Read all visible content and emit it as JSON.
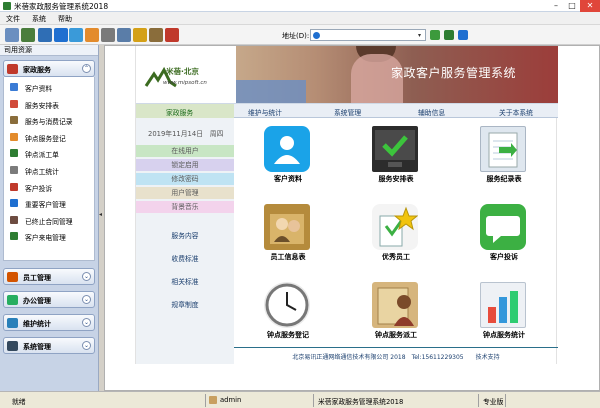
{
  "window": {
    "title": "米蓓家政服务管理系统2018"
  },
  "menu": [
    "文件",
    "系统",
    "帮助"
  ],
  "address": {
    "label": "地址(D):",
    "value": ""
  },
  "sidebar": {
    "header": "司用资源",
    "groups": [
      {
        "label": "家政服务",
        "toggle": "⌃",
        "icon_color": "#c0392b",
        "items": [
          {
            "label": "客户资料",
            "icon": "person-icon",
            "color": "#3a7bd5"
          },
          {
            "label": "服务安排表",
            "icon": "calendar-icon",
            "color": "#d14a3a"
          },
          {
            "label": "服务与消费记录",
            "icon": "record-icon",
            "color": "#8a6d3b"
          },
          {
            "label": "钟点服务登记",
            "icon": "clock-icon",
            "color": "#e38b2c"
          },
          {
            "label": "钟点派工单",
            "icon": "worker-icon",
            "color": "#2e7d32"
          },
          {
            "label": "钟点工统计",
            "icon": "stats-icon",
            "color": "#7b7b7b"
          },
          {
            "label": "客户投诉",
            "icon": "complaint-icon",
            "color": "#c0392b"
          },
          {
            "label": "重要客户管理",
            "icon": "vip-icon",
            "color": "#1f6fd0"
          },
          {
            "label": "已终止合同管理",
            "icon": "contract-icon",
            "color": "#6d4c41"
          },
          {
            "label": "客户来电管理",
            "icon": "phone-icon",
            "color": "#2e7d32"
          }
        ]
      },
      {
        "label": "员工管理",
        "toggle": "⌄",
        "icon_color": "#d35400"
      },
      {
        "label": "办公管理",
        "toggle": "⌄",
        "icon_color": "#27ae60"
      },
      {
        "label": "维护统计",
        "toggle": "⌄",
        "icon_color": "#2980b9"
      },
      {
        "label": "系统管理",
        "toggle": "⌄",
        "icon_color": "#34495e"
      }
    ]
  },
  "banner": {
    "logo_name": "米蓓·北京",
    "logo_url": "www.mipsoft.cn",
    "title": "家政客户服务管理系统"
  },
  "nav": [
    "家政服务",
    "维护与统计",
    "系统管理",
    "辅助信息",
    "关于本系统"
  ],
  "left_panel": {
    "date": "2019年11月14日　周四",
    "bars": [
      {
        "label": "在线用户",
        "color": "#c8e6c4"
      },
      {
        "label": "锁定启用",
        "color": "#d7d1ee"
      },
      {
        "label": "修改密码",
        "color": "#bfe3f3"
      },
      {
        "label": "用户管理",
        "color": "#e8e1cc"
      },
      {
        "label": "背景音乐",
        "color": "#f3d3ec"
      }
    ],
    "links": [
      "服务内容",
      "收费标准",
      "相关标准",
      "规章制度"
    ]
  },
  "tiles": [
    {
      "label": "客户资料",
      "icon": "customer-icon",
      "color": "#1aa3e8"
    },
    {
      "label": "服务安排表",
      "icon": "schedule-icon",
      "color": "#3b3b3b"
    },
    {
      "label": "服务纪录表",
      "icon": "record-sheet-icon",
      "color": "#dfe7ef"
    },
    {
      "label": "员工信息表",
      "icon": "staff-icon",
      "color": "#b58b3c"
    },
    {
      "label": "优秀员工",
      "icon": "star-book-icon",
      "color": "#f0f0f0"
    },
    {
      "label": "客户投诉",
      "icon": "chat-icon",
      "color": "#3cb043"
    },
    {
      "label": "钟点服务登记",
      "icon": "clock-icon",
      "color": "#e6e6e6"
    },
    {
      "label": "钟点服务派工",
      "icon": "dispatch-icon",
      "color": "#c9a66b"
    },
    {
      "label": "钟点服务统计",
      "icon": "chart-icon",
      "color": "#eef1f5"
    }
  ],
  "footer": "北京易讯正通网络通信技术有限公司 2018　Tel:15611229305　　技术支持",
  "status": {
    "ready": "就绪",
    "user": "admin",
    "app": "米蓓家政服务管理系统2018",
    "edition": "专业版"
  }
}
